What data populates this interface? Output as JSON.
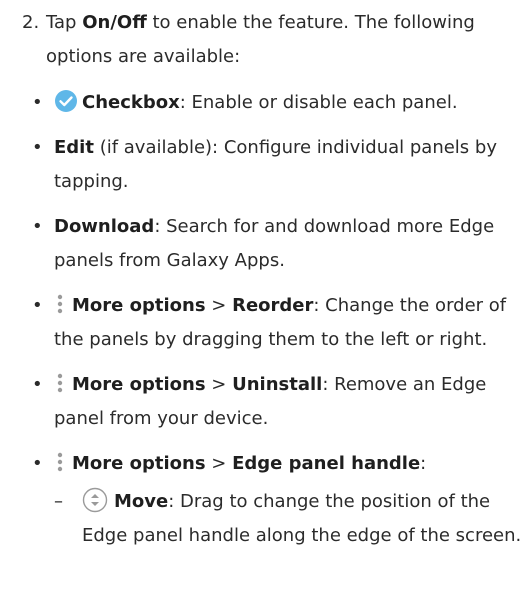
{
  "step": {
    "number": "2.",
    "pre": "Tap ",
    "bold": "On/Off",
    "post": " to enable the feature. The following options are available:"
  },
  "bullets": [
    {
      "icon": "checkbox-icon",
      "bold": "Checkbox",
      "text": ": Enable or disable each panel."
    },
    {
      "bold": "Edit",
      "text": " (if available): Configure individual panels by tapping."
    },
    {
      "bold": "Download",
      "text": ": Search for and download more Edge panels from Galaxy Apps."
    },
    {
      "icon": "more-options-icon",
      "bold": "More options",
      "sep": " > ",
      "bold2": "Reorder",
      "text": ": Change the order of the panels by dragging them to the left or right."
    },
    {
      "icon": "more-options-icon",
      "bold": "More options",
      "sep": " > ",
      "bold2": "Uninstall",
      "text": ": Remove an Edge panel from your device."
    },
    {
      "icon": "more-options-icon",
      "bold": "More options",
      "sep": " > ",
      "bold2": "Edge panel handle",
      "text": ":"
    }
  ],
  "sub_bullet": {
    "dash": "–",
    "icon": "move-icon",
    "bold": "Move",
    "text": ": Drag to change the position of the Edge panel handle along the edge of the screen."
  },
  "bullet_glyph": "•",
  "colors": {
    "checkbox": "#5fb7e8",
    "icon_gray": "#9a9a9a",
    "text": "#2b2b2b"
  }
}
